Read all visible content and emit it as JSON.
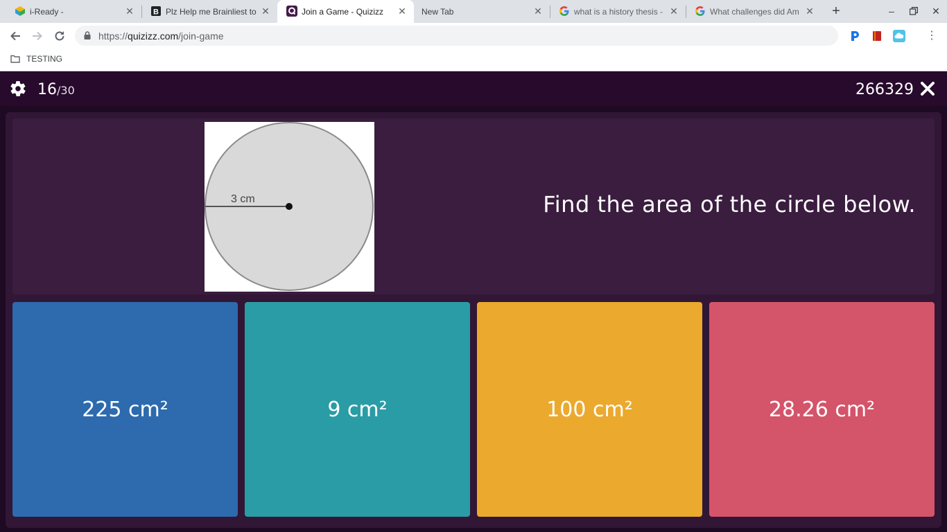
{
  "browser": {
    "tabs": [
      {
        "title": "i-Ready -",
        "active": false
      },
      {
        "title": "Plz Help me Brainliest to",
        "active": false
      },
      {
        "title": "Join a Game - Quizizz",
        "active": true
      },
      {
        "title": "New Tab",
        "active": false
      },
      {
        "title": "what is a history thesis -",
        "active": false
      },
      {
        "title": "What challenges did Am",
        "active": false
      }
    ],
    "url_scheme": "https://",
    "url_host": "quizizz.com",
    "url_path": "/join-game",
    "bookmarks": [
      {
        "label": "TESTING"
      }
    ]
  },
  "quiz": {
    "current": "16",
    "total": "/30",
    "game_code": "266329",
    "question": "Find the area of the circle below.",
    "figure_label": "3 cm",
    "options": [
      {
        "label": "225 cm²",
        "color": "#2d6aae"
      },
      {
        "label": "9 cm²",
        "color": "#2a9ca5"
      },
      {
        "label": "100 cm²",
        "color": "#eba92e"
      },
      {
        "label": "28.26 cm²",
        "color": "#d4546a"
      }
    ]
  }
}
